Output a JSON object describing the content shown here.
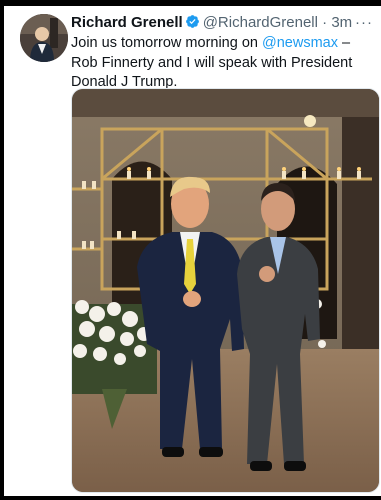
{
  "tweet": {
    "display_name": "Richard Grenell",
    "handle": "@RichardGrenell",
    "separator": "·",
    "time": "3m",
    "more_label": "···",
    "text_before": "Join us tomorrow morning on ",
    "mention": "@newsmax",
    "text_after": " – Rob Finnerty and I will speak with President Donald J Trump.",
    "icons": {
      "avatar": "avatar-photo",
      "verified": "verified-badge-icon",
      "more": "more-options-icon"
    }
  },
  "colors": {
    "text": "#0f1419",
    "secondary": "#536471",
    "link": "#1d9bf0",
    "verified": "#1d9bf0"
  }
}
